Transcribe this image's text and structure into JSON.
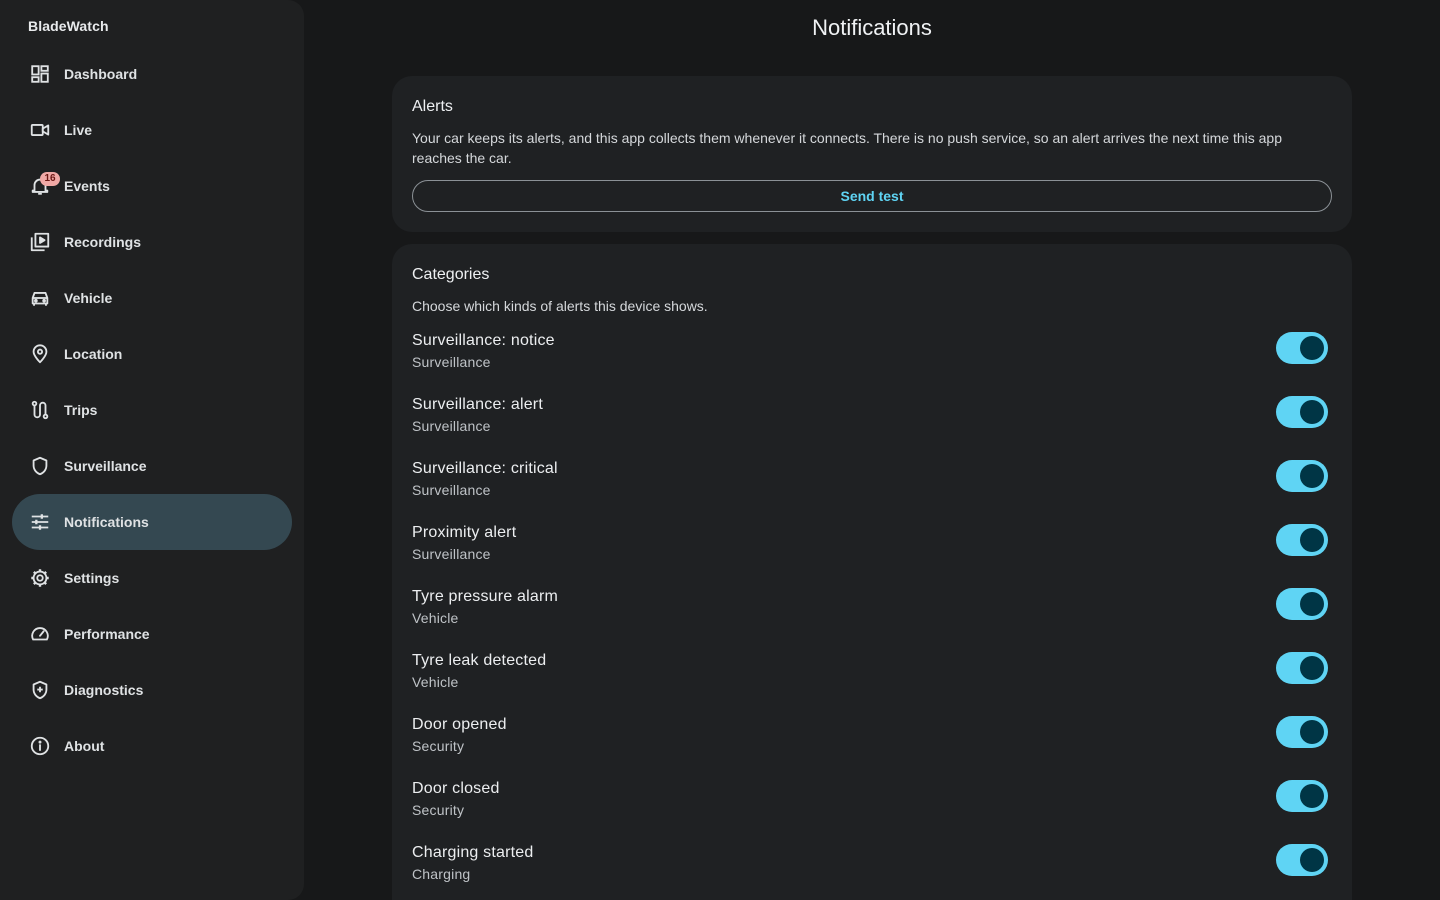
{
  "app": {
    "name": "BladeWatch"
  },
  "sidebar": {
    "items": [
      {
        "label": "Dashboard",
        "icon": "dashboard-icon"
      },
      {
        "label": "Live",
        "icon": "videocam-icon"
      },
      {
        "label": "Events",
        "icon": "bell-icon",
        "badge": "16"
      },
      {
        "label": "Recordings",
        "icon": "video-library-icon"
      },
      {
        "label": "Vehicle",
        "icon": "car-icon"
      },
      {
        "label": "Location",
        "icon": "location-pin-icon"
      },
      {
        "label": "Trips",
        "icon": "route-icon"
      },
      {
        "label": "Surveillance",
        "icon": "shield-icon"
      },
      {
        "label": "Notifications",
        "icon": "tune-icon",
        "active": true
      },
      {
        "label": "Settings",
        "icon": "gear-icon"
      },
      {
        "label": "Performance",
        "icon": "speedometer-icon"
      },
      {
        "label": "Diagnostics",
        "icon": "health-shield-icon"
      },
      {
        "label": "About",
        "icon": "info-icon"
      }
    ]
  },
  "page": {
    "title": "Notifications"
  },
  "alerts": {
    "title": "Alerts",
    "description": "Your car keeps its alerts, and this app collects them whenever it connects. There is no push service, so an alert arrives the next time this app reaches the car.",
    "send_test_label": "Send test"
  },
  "categories": {
    "title": "Categories",
    "description": "Choose which kinds of alerts this device shows.",
    "items": [
      {
        "name": "Surveillance: notice",
        "group": "Surveillance",
        "enabled": true
      },
      {
        "name": "Surveillance: alert",
        "group": "Surveillance",
        "enabled": true
      },
      {
        "name": "Surveillance: critical",
        "group": "Surveillance",
        "enabled": true
      },
      {
        "name": "Proximity alert",
        "group": "Surveillance",
        "enabled": true
      },
      {
        "name": "Tyre pressure alarm",
        "group": "Vehicle",
        "enabled": true
      },
      {
        "name": "Tyre leak detected",
        "group": "Vehicle",
        "enabled": true
      },
      {
        "name": "Door opened",
        "group": "Security",
        "enabled": true
      },
      {
        "name": "Door closed",
        "group": "Security",
        "enabled": true
      },
      {
        "name": "Charging started",
        "group": "Charging",
        "enabled": true
      }
    ]
  },
  "colors": {
    "accent": "#5fd4f4",
    "active_nav": "#344851",
    "badge": "#f1a9a6"
  }
}
